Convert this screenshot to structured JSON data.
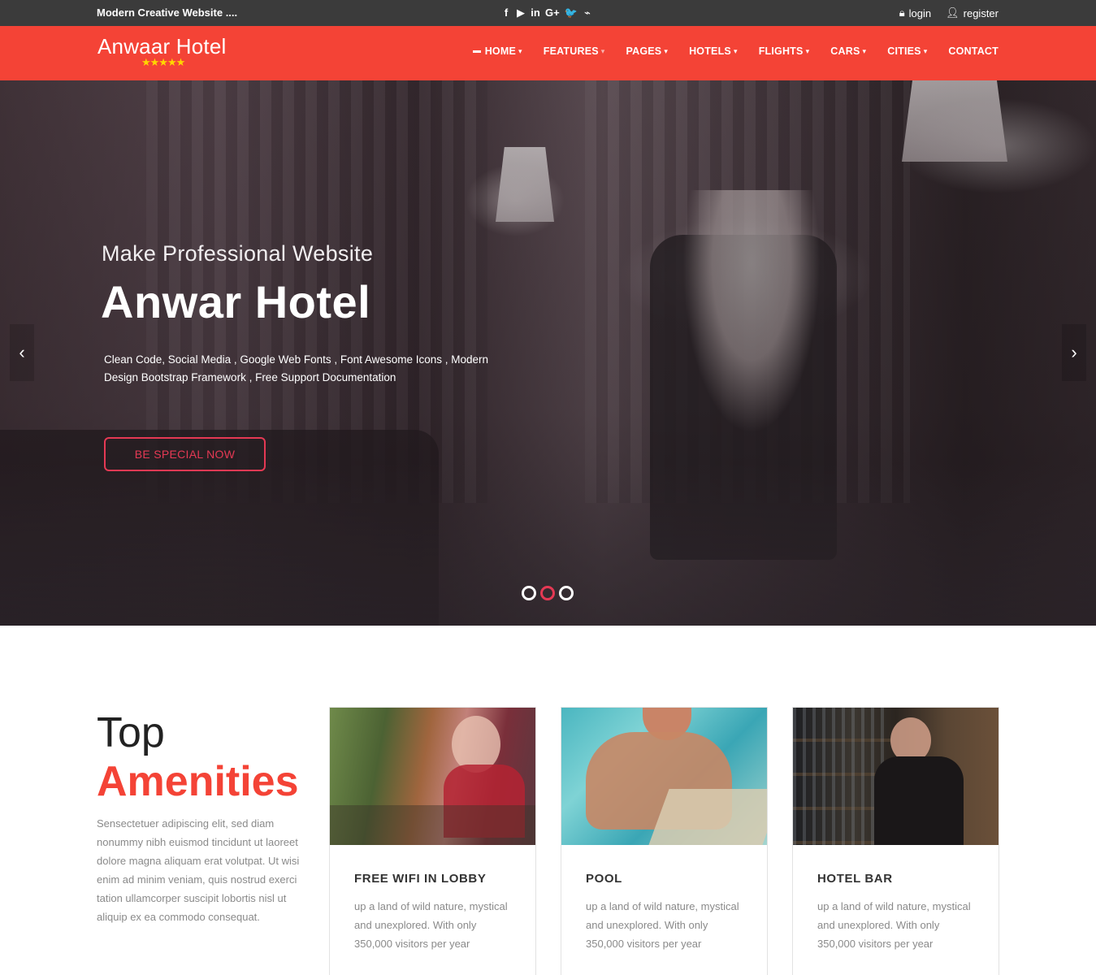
{
  "topbar": {
    "tagline": "Modern Creative Website ....",
    "social_icons": [
      {
        "name": "facebook-icon",
        "glyph": "f"
      },
      {
        "name": "youtube-icon",
        "glyph": "▶"
      },
      {
        "name": "linkedin-icon",
        "glyph": "in"
      },
      {
        "name": "google-plus-icon",
        "glyph": "G+"
      },
      {
        "name": "twitter-icon",
        "glyph": "🐦"
      },
      {
        "name": "rss-icon",
        "glyph": "⌁"
      }
    ],
    "login_label": "login",
    "register_label": "register"
  },
  "navbar": {
    "brand": "Anwaar Hotel",
    "stars": "★★★★★",
    "menu": [
      {
        "label": "HOME",
        "dropdown": true,
        "active": true
      },
      {
        "label": "FEATURES",
        "dropdown": true
      },
      {
        "label": "PAGES",
        "dropdown": true
      },
      {
        "label": "HOTELS",
        "dropdown": true
      },
      {
        "label": "FLIGHTS",
        "dropdown": true
      },
      {
        "label": "CARS",
        "dropdown": true
      },
      {
        "label": "CITIES",
        "dropdown": true
      },
      {
        "label": "CONTACT",
        "dropdown": false
      }
    ]
  },
  "hero": {
    "subtitle": "Make Professional Website",
    "title": "Anwar Hotel",
    "desc_line1": "Clean Code, Social Media , Google Web Fonts , Font Awesome Icons , Modern",
    "desc_line2": "Design Bootstrap Framework , Free Support Documentation",
    "cta": "BE SPECIAL NOW",
    "prev_glyph": "‹",
    "next_glyph": "›",
    "slides_total": 3,
    "active_slide": 2
  },
  "amenities": {
    "heading_top": "Top",
    "heading_main": "Amenities",
    "text": "Sensectetuer adipiscing elit, sed diam nonummy nibh euismod tincidunt ut laoreet dolore magna aliquam erat volutpat. Ut wisi enim ad minim veniam, quis nostrud exerci tation ullamcorper suscipit lobortis nisl ut aliquip ex ea commodo consequat.",
    "cards": [
      {
        "title": "FREE WIFI IN LOBBY",
        "text": "up a land of wild nature, mystical and unexplored. With only 350,000 visitors per year"
      },
      {
        "title": "POOL",
        "text": "up a land of wild nature, mystical and unexplored. With only 350,000 visitors per year"
      },
      {
        "title": "HOTEL BAR",
        "text": "up a land of wild nature, mystical and unexplored. With only 350,000 visitors per year"
      }
    ]
  },
  "colors": {
    "accent": "#f44336",
    "topbar": "#3b3b3b",
    "cta": "#e53954",
    "stars": "#ffd600"
  }
}
